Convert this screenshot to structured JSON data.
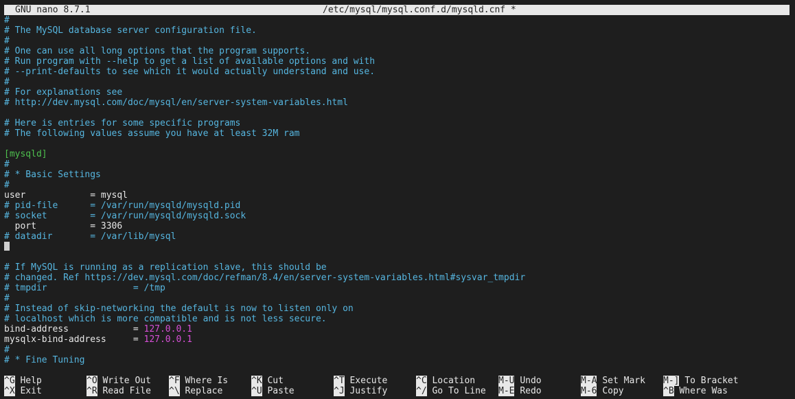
{
  "titlebar": {
    "app": "GNU nano 8.7.1",
    "file": "/etc/mysql/mysql.conf.d/mysqld.cnf *"
  },
  "editor": {
    "lines": [
      [
        {
          "t": "#",
          "c": "comment"
        }
      ],
      [
        {
          "t": "# The MySQL database server configuration file.",
          "c": "comment"
        }
      ],
      [
        {
          "t": "#",
          "c": "comment"
        }
      ],
      [
        {
          "t": "# One can use all long options that the program supports.",
          "c": "comment"
        }
      ],
      [
        {
          "t": "# Run program with --help to get a list of available options and with",
          "c": "comment"
        }
      ],
      [
        {
          "t": "# --print-defaults to see which it would actually understand and use.",
          "c": "comment"
        }
      ],
      [
        {
          "t": "#",
          "c": "comment"
        }
      ],
      [
        {
          "t": "# For explanations see",
          "c": "comment"
        }
      ],
      [
        {
          "t": "# http://dev.mysql.com/doc/mysql/en/server-system-variables.html",
          "c": "comment"
        }
      ],
      [],
      [
        {
          "t": "# Here is entries for some specific programs",
          "c": "comment"
        }
      ],
      [
        {
          "t": "# The following values assume you have at least 32M ram",
          "c": "comment"
        }
      ],
      [],
      [
        {
          "t": "[mysqld]",
          "c": "section"
        }
      ],
      [
        {
          "t": "#",
          "c": "comment"
        }
      ],
      [
        {
          "t": "# * Basic Settings",
          "c": "comment"
        }
      ],
      [
        {
          "t": "#",
          "c": "comment"
        }
      ],
      [
        {
          "t": "user            = mysql",
          "c": "plain"
        }
      ],
      [
        {
          "t": "# pid-file      = /var/run/mysqld/mysqld.pid",
          "c": "comment"
        }
      ],
      [
        {
          "t": "# socket        = /var/run/mysqld/mysqld.sock",
          "c": "comment"
        }
      ],
      [
        {
          "t": "  port          = 3306",
          "c": "plain"
        }
      ],
      [
        {
          "t": "# datadir       = /var/lib/mysql",
          "c": "comment"
        }
      ],
      [
        {
          "t": "",
          "c": "cursor"
        }
      ],
      [],
      [
        {
          "t": "# If MySQL is running as a replication slave, this should be",
          "c": "comment"
        }
      ],
      [
        {
          "t": "# changed. Ref https://dev.mysql.com/doc/refman/8.4/en/server-system-variables.html#sysvar_tmpdir",
          "c": "comment"
        }
      ],
      [
        {
          "t": "# tmpdir                = /tmp",
          "c": "comment"
        }
      ],
      [
        {
          "t": "#",
          "c": "comment"
        }
      ],
      [
        {
          "t": "# Instead of skip-networking the default is now to listen only on",
          "c": "comment"
        }
      ],
      [
        {
          "t": "# localhost which is more compatible and is not less secure.",
          "c": "comment"
        }
      ],
      [
        {
          "t": "bind-address            = ",
          "c": "plain"
        },
        {
          "t": "127.0.0.1",
          "c": "value"
        }
      ],
      [
        {
          "t": "mysqlx-bind-address     = ",
          "c": "plain"
        },
        {
          "t": "127.0.0.1",
          "c": "value"
        }
      ],
      [
        {
          "t": "#",
          "c": "comment"
        }
      ],
      [
        {
          "t": "# * Fine Tuning",
          "c": "comment"
        }
      ]
    ]
  },
  "shortcuts": [
    {
      "key": "^G",
      "label": "Help"
    },
    {
      "key": "^O",
      "label": "Write Out"
    },
    {
      "key": "^F",
      "label": "Where Is"
    },
    {
      "key": "^K",
      "label": "Cut"
    },
    {
      "key": "^T",
      "label": "Execute"
    },
    {
      "key": "^C",
      "label": "Location"
    },
    {
      "key": "M-U",
      "label": "Undo"
    },
    {
      "key": "M-A",
      "label": "Set Mark"
    },
    {
      "key": "M-]",
      "label": "To Bracket"
    },
    {
      "key": "^X",
      "label": "Exit"
    },
    {
      "key": "^R",
      "label": "Read File"
    },
    {
      "key": "^\\",
      "label": "Replace"
    },
    {
      "key": "^U",
      "label": "Paste"
    },
    {
      "key": "^J",
      "label": "Justify"
    },
    {
      "key": "^/",
      "label": "Go To Line"
    },
    {
      "key": "M-E",
      "label": "Redo"
    },
    {
      "key": "M-6",
      "label": "Copy"
    },
    {
      "key": "^B",
      "label": "Where Was"
    }
  ],
  "colors": {
    "background": "#1e1e1e",
    "foreground": "#e8e8e8",
    "comment": "#56b6e0",
    "section": "#4ec04e",
    "value": "#d64fd6"
  }
}
